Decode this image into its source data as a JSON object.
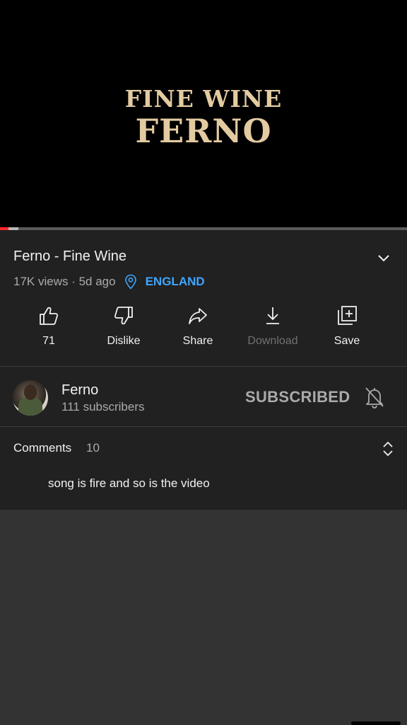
{
  "video": {
    "overlay_line1": "FINE WINE",
    "overlay_line2": "FERNO",
    "progress_played_fraction": 0.02,
    "progress_buffered_fraction": 0.045
  },
  "details": {
    "title": "Ferno - Fine Wine",
    "views": "17K views",
    "separator": " · ",
    "age": "5d ago",
    "location": "ENGLAND"
  },
  "actions": {
    "like_count": "71",
    "dislike_label": "Dislike",
    "share_label": "Share",
    "download_label": "Download",
    "save_label": "Save"
  },
  "channel": {
    "name": "Ferno",
    "subscribers": "111 subscribers",
    "subscribe_state": "SUBSCRIBED"
  },
  "comments": {
    "title": "Comments",
    "count": "10",
    "top_comment": "song is fire and so is the video"
  },
  "colors": {
    "accent_link": "#3ea6ff",
    "progress_red": "#ff2a2a",
    "overlay_gold": "#e3cba1",
    "panel_bg": "#212121"
  }
}
